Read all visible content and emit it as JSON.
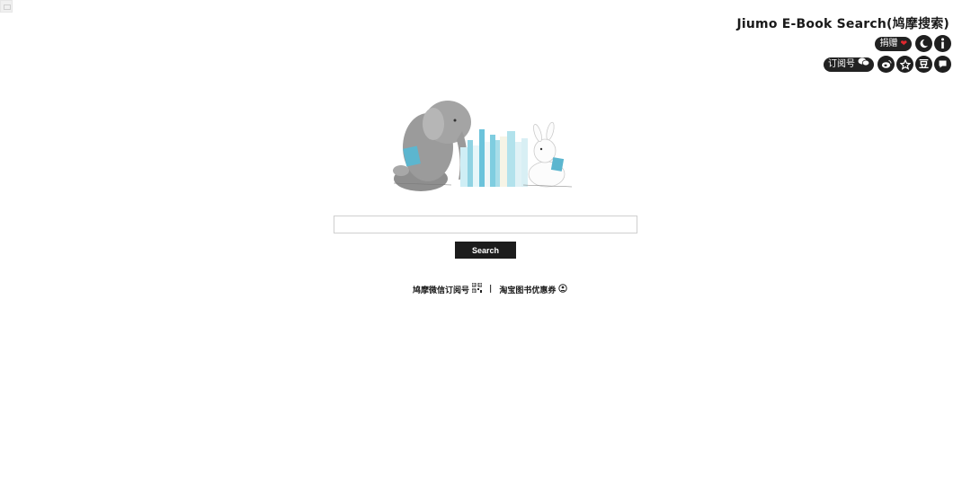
{
  "header": {
    "title": "Jiumo E-Book Search(鸠摩搜索)",
    "donate_label": "捐赠",
    "subscribe_label": "订阅号"
  },
  "icons": {
    "heart": "heart-icon",
    "moon": "moon-icon",
    "info": "info-icon",
    "wechat": "wechat-icon",
    "weibo": "weibo-icon",
    "star": "star-icon",
    "douban": "douban-icon",
    "feedback": "chat-bubble-icon"
  },
  "glyphs": {
    "heart": "❤",
    "douban": "豆"
  },
  "search": {
    "placeholder": "",
    "value": "",
    "button_label": "Search"
  },
  "footer": {
    "link1": "鸠摩微信订阅号",
    "separator": "|",
    "link2": "淘宝图书优惠券"
  },
  "colors": {
    "accent": "#1c1c1c",
    "heart": "#e0282f",
    "book_blue": "#7fcde0"
  }
}
